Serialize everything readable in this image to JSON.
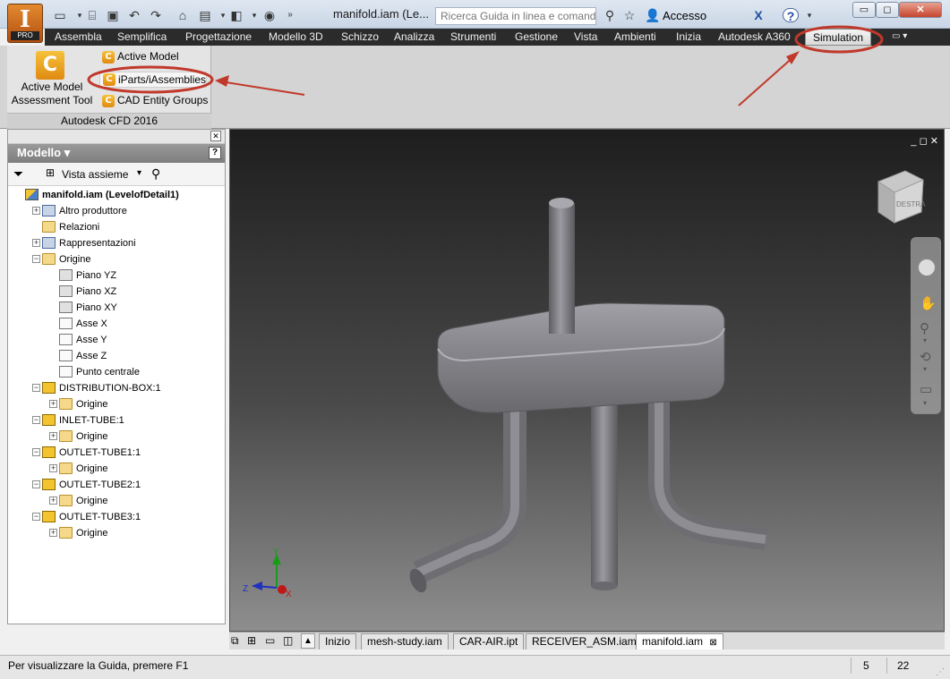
{
  "window": {
    "title": "manifold.iam (Le...",
    "app_letter": "I",
    "app_edition": "PRO",
    "help_placeholder": "Ricerca Guida in linea e comand",
    "access_label": "Accesso",
    "minimize": "▭",
    "restore": "◻",
    "close": "✕"
  },
  "qat": {
    "new_icon": "new-file-icon",
    "open_icon": "folder-open-icon",
    "save_icon": "save-icon",
    "undo_icon": "undo-icon",
    "redo_icon": "redo-icon",
    "home_icon": "home-icon"
  },
  "menu": {
    "items": [
      "Assembla",
      "Semplifica",
      "Progettazione",
      "Modello 3D",
      "Schizzo",
      "Analizza",
      "Strumenti",
      "Gestione",
      "Vista",
      "Ambienti",
      "Inizia",
      "Autodesk A360",
      "Simulation"
    ],
    "overflow": "▭ ▾"
  },
  "ribbon": {
    "panel_label": "Autodesk CFD 2016",
    "big_tool": "Active Model Assessment Tool",
    "big_tool_line1": "Active Model",
    "big_tool_line2": "Assessment Tool",
    "tools": [
      "Active Model",
      "iParts/iAssemblies",
      "CAD Entity Groups"
    ]
  },
  "browser": {
    "title": "Modello ▾",
    "help": "?",
    "view_label": "Vista assieme",
    "tree": [
      {
        "label": "manifold.iam (LevelofDetail1)",
        "level": 0,
        "icon": "asm",
        "exp": "",
        "bold": true
      },
      {
        "label": "Altro produttore",
        "level": 1,
        "icon": "gear",
        "exp": "+"
      },
      {
        "label": "Relazioni",
        "level": 1,
        "icon": "folder",
        "exp": ""
      },
      {
        "label": "Rappresentazioni",
        "level": 1,
        "icon": "gear",
        "exp": "+"
      },
      {
        "label": "Origine",
        "level": 1,
        "icon": "folder",
        "exp": "−"
      },
      {
        "label": "Piano YZ",
        "level": 2,
        "icon": "plane",
        "exp": ""
      },
      {
        "label": "Piano XZ",
        "level": 2,
        "icon": "plane",
        "exp": ""
      },
      {
        "label": "Piano XY",
        "level": 2,
        "icon": "plane",
        "exp": ""
      },
      {
        "label": "Asse X",
        "level": 2,
        "icon": "axis",
        "exp": ""
      },
      {
        "label": "Asse Y",
        "level": 2,
        "icon": "axis",
        "exp": ""
      },
      {
        "label": "Asse Z",
        "level": 2,
        "icon": "axis",
        "exp": ""
      },
      {
        "label": "Punto centrale",
        "level": 2,
        "icon": "axis",
        "exp": ""
      },
      {
        "label": "DISTRIBUTION-BOX:1",
        "level": 1,
        "icon": "part",
        "exp": "−"
      },
      {
        "label": "Origine",
        "level": 2,
        "icon": "folder",
        "exp": "+"
      },
      {
        "label": "INLET-TUBE:1",
        "level": 1,
        "icon": "part",
        "exp": "−"
      },
      {
        "label": "Origine",
        "level": 2,
        "icon": "folder",
        "exp": "+"
      },
      {
        "label": "OUTLET-TUBE1:1",
        "level": 1,
        "icon": "part",
        "exp": "−"
      },
      {
        "label": "Origine",
        "level": 2,
        "icon": "folder",
        "exp": "+"
      },
      {
        "label": "OUTLET-TUBE2:1",
        "level": 1,
        "icon": "part",
        "exp": "−"
      },
      {
        "label": "Origine",
        "level": 2,
        "icon": "folder",
        "exp": "+"
      },
      {
        "label": "OUTLET-TUBE3:1",
        "level": 1,
        "icon": "part",
        "exp": "−"
      },
      {
        "label": "Origine",
        "level": 2,
        "icon": "folder",
        "exp": "+"
      }
    ]
  },
  "viewport": {
    "viewcube_label": "DESTRA",
    "axis_x": "X",
    "axis_y": "Y",
    "axis_z": "Z",
    "controls": "_ ◻ ✕"
  },
  "doc_tabs": [
    "Inizio",
    "mesh-study.iam",
    "CAR-AIR.ipt",
    "RECEIVER_ASM.iam",
    "manifold.iam"
  ],
  "doc_tab_close": "⊠",
  "status": {
    "text": "Per visualizzare la Guida, premere F1",
    "count1": "5",
    "count2": "22"
  },
  "colors": {
    "menu_bar": "#2b2b2b",
    "annotation_red": "#c0392b",
    "ribbon_icon": "#f0a820",
    "model_gray": "#7a7a7e"
  }
}
